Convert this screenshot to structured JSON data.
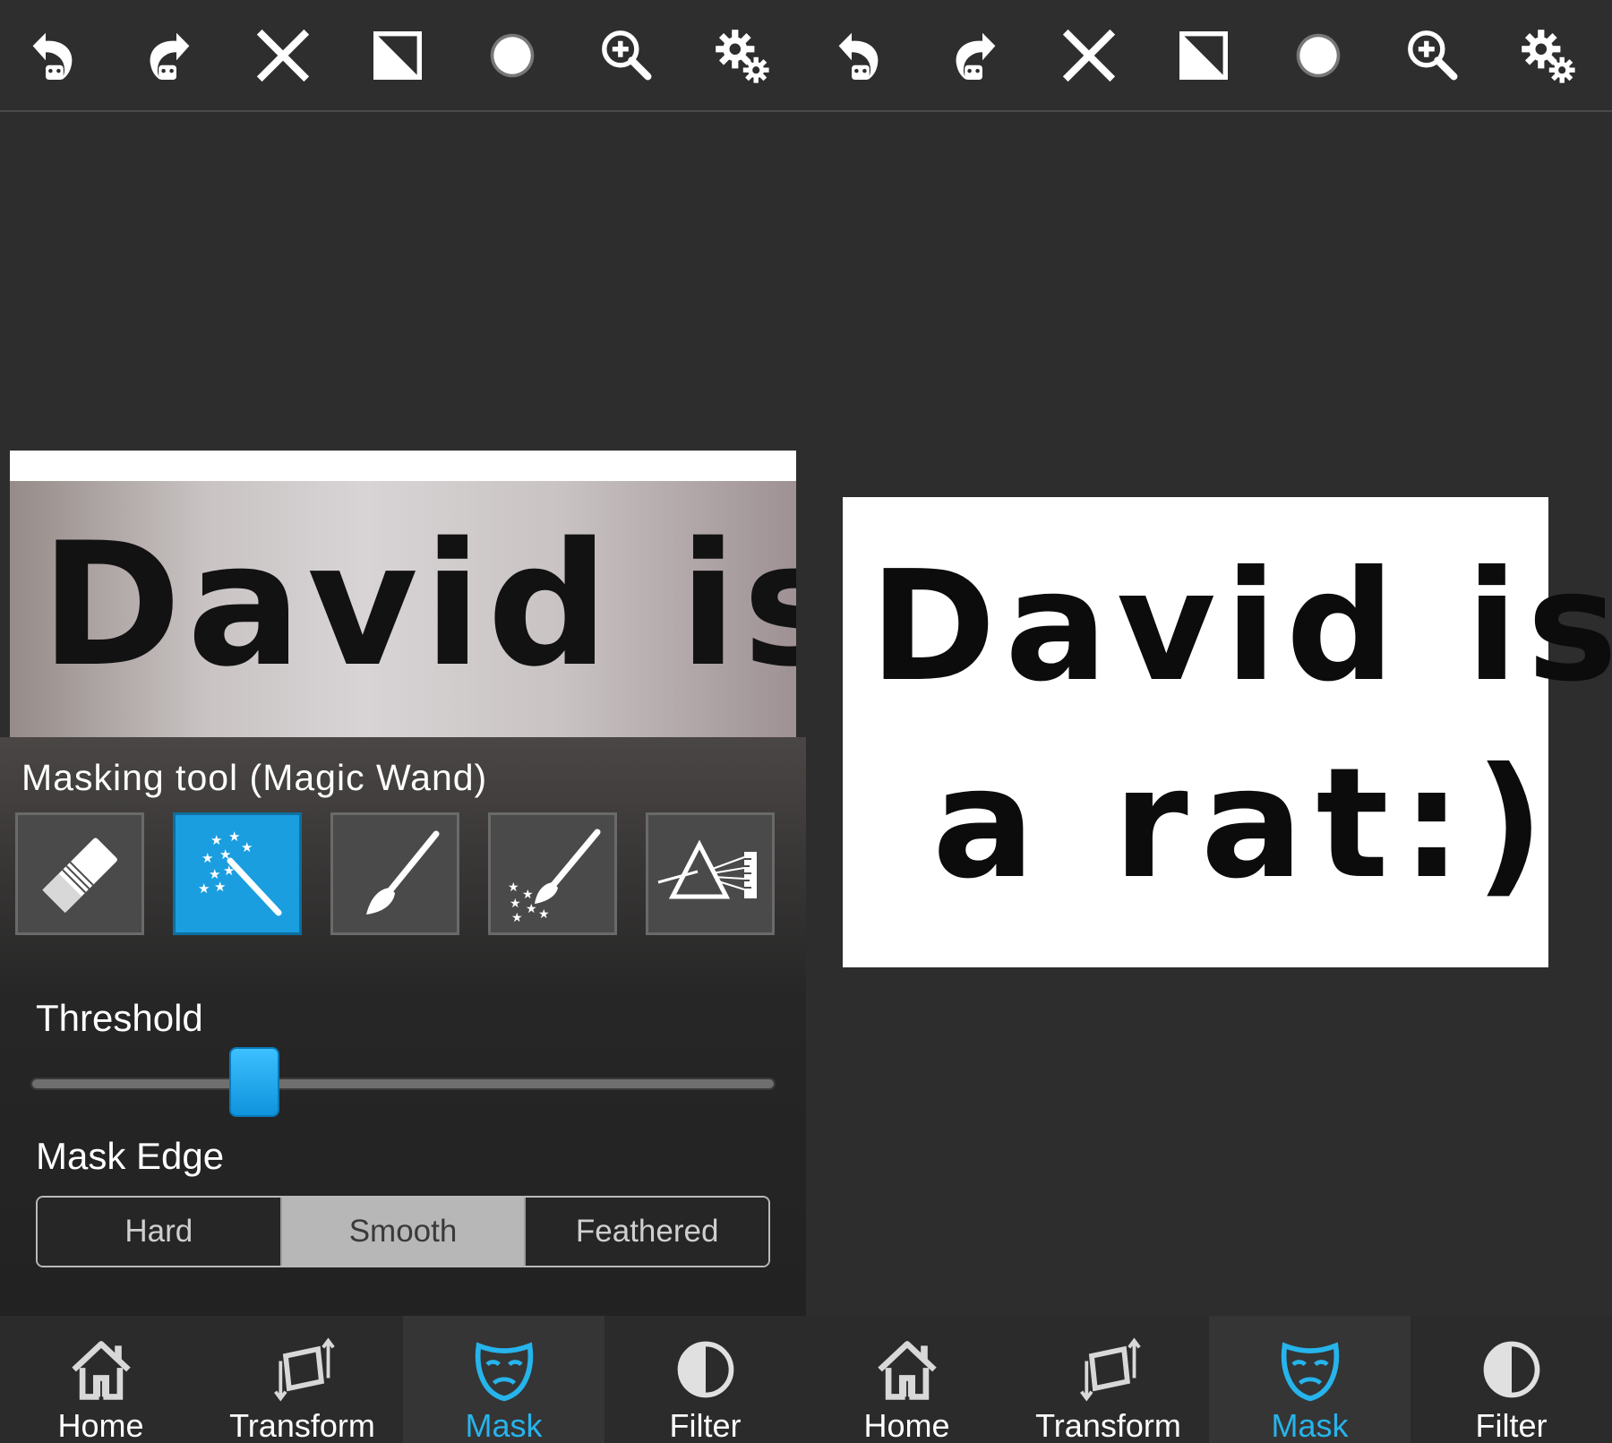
{
  "colors": {
    "background": "#2d2d2d",
    "accent": "#1a9ee0",
    "active_label": "#26b4ec",
    "toolbar_icon": "#ffffff"
  },
  "toolbar": {
    "icons": [
      "undo-icon",
      "redo-icon",
      "close-icon",
      "invert-icon",
      "brush-size-icon",
      "zoom-in-icon",
      "settings-icon"
    ]
  },
  "left": {
    "photo": {
      "text": "David is"
    },
    "masking_tool": {
      "title": "Masking tool (Magic Wand)",
      "tools": [
        "eraser-icon",
        "magic-wand-icon",
        "brush-icon",
        "sparkle-brush-icon",
        "prism-icon"
      ],
      "active_tool": "magic-wand-icon"
    },
    "threshold": {
      "label": "Threshold",
      "value_fraction": 0.3
    },
    "mask_edge": {
      "label": "Mask Edge",
      "options": [
        "Hard",
        "Smooth",
        "Feathered"
      ],
      "selected": "Smooth"
    }
  },
  "right": {
    "result": {
      "line1": "David is",
      "line2": "a rat:)"
    }
  },
  "nav": {
    "items": [
      {
        "label": "Home",
        "icon": "home-icon"
      },
      {
        "label": "Transform",
        "icon": "transform-icon"
      },
      {
        "label": "Mask",
        "icon": "mask-icon"
      },
      {
        "label": "Filter",
        "icon": "filter-icon"
      }
    ],
    "active": "Mask"
  }
}
